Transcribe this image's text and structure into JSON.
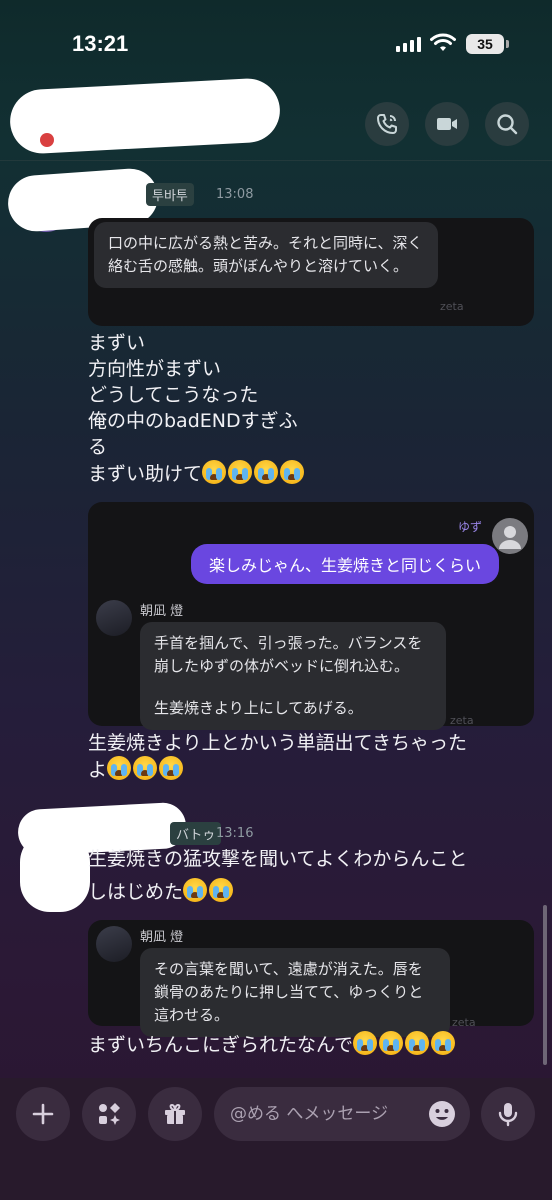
{
  "status": {
    "time": "13:21",
    "battery": "35"
  },
  "header": {
    "call_icon": "phone-icon",
    "video_icon": "video-icon",
    "search_icon": "search-icon"
  },
  "messages": {
    "m1": {
      "tag": "투바투",
      "time": "13:08",
      "bot_text": "口の中に広がる熱と苦み。それと同時に、深く絡む舌の感触。頭がぼんやりと溶けていく。",
      "watermark": "zeta",
      "lines": [
        "まずい",
        "方向性がまずい",
        "どうしてこうなった",
        "俺の中のbadENDすぎふ",
        "る",
        "まずい助けて"
      ]
    },
    "m2": {
      "user_name": "ゆず",
      "user_text": "楽しみじゃん、生姜焼きと同じくらい",
      "bot_name": "朝凪 燈",
      "bot_text_1": "手首を掴んで、引っ張った。バランスを崩したゆずの体がベッドに倒れ込む。",
      "bot_text_2": "生姜焼きより上にしてあげる。",
      "watermark": "zeta",
      "line_1": "生姜焼きより上とかいう単語出てきちゃった",
      "line_2": "よ"
    },
    "m3": {
      "tag": "バトゥ",
      "time": "13:16",
      "line_1": "生姜焼きの猛攻撃を聞いてよくわからんこと",
      "line_2": "しはじめた",
      "bot_name": "朝凪 燈",
      "bot_text": "その言葉を聞いて、遠慮が消えた。唇を鎖骨のあたりに押し当てて、ゆっくりと這わせる。",
      "watermark": "zeta",
      "line_3": "まずいちんこにぎられたなんで"
    }
  },
  "composer": {
    "placeholder": "@める へメッセージ",
    "plus_icon": "plus-icon",
    "apps_icon": "apps-icon",
    "gift_icon": "gift-icon",
    "emoji_icon": "emoji-icon",
    "mic_icon": "microphone-icon"
  }
}
